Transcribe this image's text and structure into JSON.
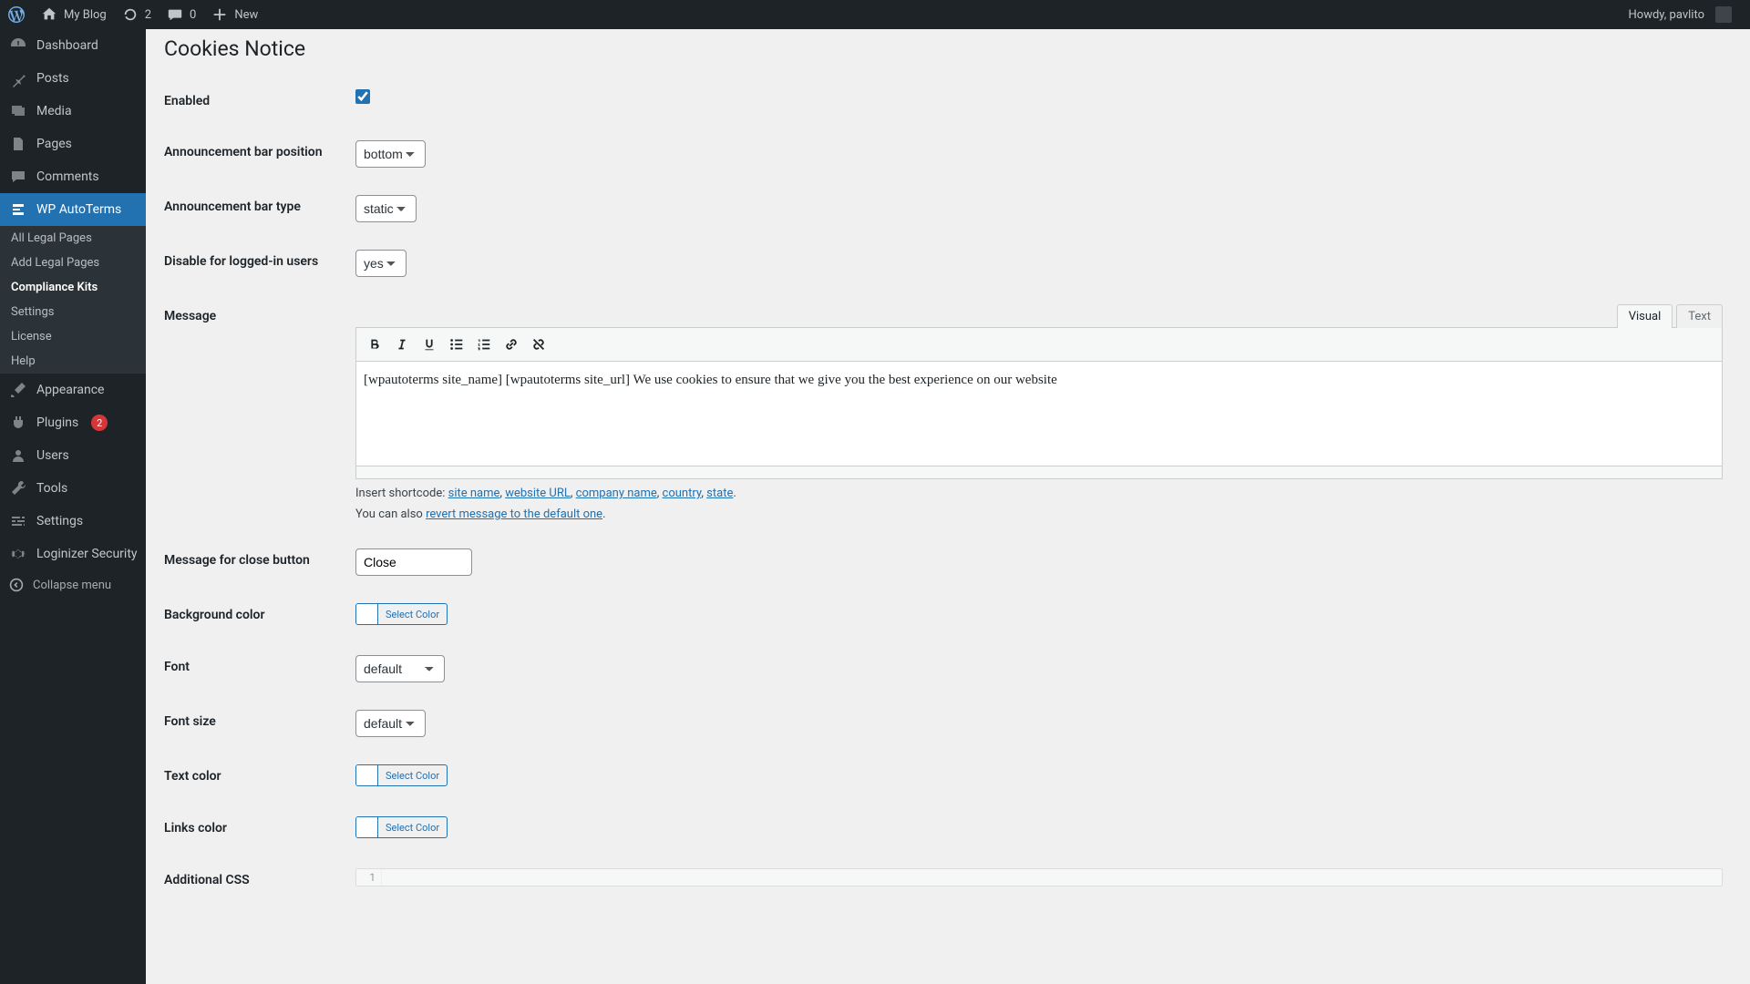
{
  "adminbar": {
    "site_title": "My Blog",
    "updates_count": "2",
    "comments_count": "0",
    "new": "New",
    "howdy": "Howdy, pavlito"
  },
  "menu": {
    "dashboard": "Dashboard",
    "posts": "Posts",
    "media": "Media",
    "pages": "Pages",
    "comments": "Comments",
    "autoterms": "WP AutoTerms",
    "appearance": "Appearance",
    "plugins": "Plugins",
    "plugins_badge": "2",
    "users": "Users",
    "tools": "Tools",
    "settings": "Settings",
    "loginizer": "Loginizer Security",
    "collapse": "Collapse menu"
  },
  "submenu": {
    "all_legal": "All Legal Pages",
    "add_legal": "Add Legal Pages",
    "compliance": "Compliance Kits",
    "settings": "Settings",
    "license": "License",
    "help": "Help"
  },
  "page": {
    "title": "Cookies Notice"
  },
  "fields": {
    "enabled": "Enabled",
    "bar_position": "Announcement bar position",
    "bar_type": "Announcement bar type",
    "disable_logged_in": "Disable for logged-in users",
    "message": "Message",
    "close_message": "Message for close button",
    "bg_color": "Background color",
    "font": "Font",
    "font_size": "Font size",
    "text_color": "Text color",
    "links_color": "Links color",
    "additional_css": "Additional CSS"
  },
  "values": {
    "bar_position": "bottom",
    "bar_type": "static",
    "disable_logged_in": "yes",
    "close": "Close",
    "font": "default",
    "font_size": "default",
    "select_color": "Select Color",
    "bg_swatch": "#ffffff",
    "text_swatch": "#ffffff",
    "links_swatch": "#ffffff",
    "css_line": "1"
  },
  "editor": {
    "tab_visual": "Visual",
    "tab_text": "Text",
    "content": "[wpautoterms site_name] [wpautoterms site_url] We use cookies to ensure that we give you the best experience on our website",
    "insert_prefix": "Insert shortcode: ",
    "sc_site_name": "site name",
    "sc_website_url": "website URL",
    "sc_company": "company name",
    "sc_country": "country",
    "sc_state": "state",
    "also_prefix": "You can also ",
    "revert": "revert message to the default one"
  }
}
